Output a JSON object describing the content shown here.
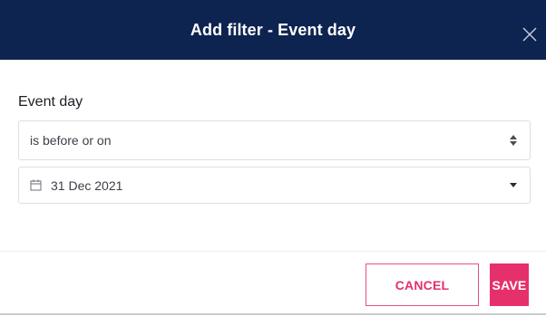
{
  "modal": {
    "title": "Add filter - Event day",
    "close_icon": "close-icon",
    "header_color": "#0d2350"
  },
  "form": {
    "label": "Event day",
    "operator": {
      "selected": "is before or on",
      "icon": "updown-arrows-icon"
    },
    "date": {
      "value": "31 Dec 2021",
      "icon": "calendar-icon",
      "dropdown_icon": "caret-down-icon"
    }
  },
  "footer": {
    "cancel_label": "CANCEL",
    "save_label": "SAVE",
    "accent_color": "#e5306c"
  }
}
